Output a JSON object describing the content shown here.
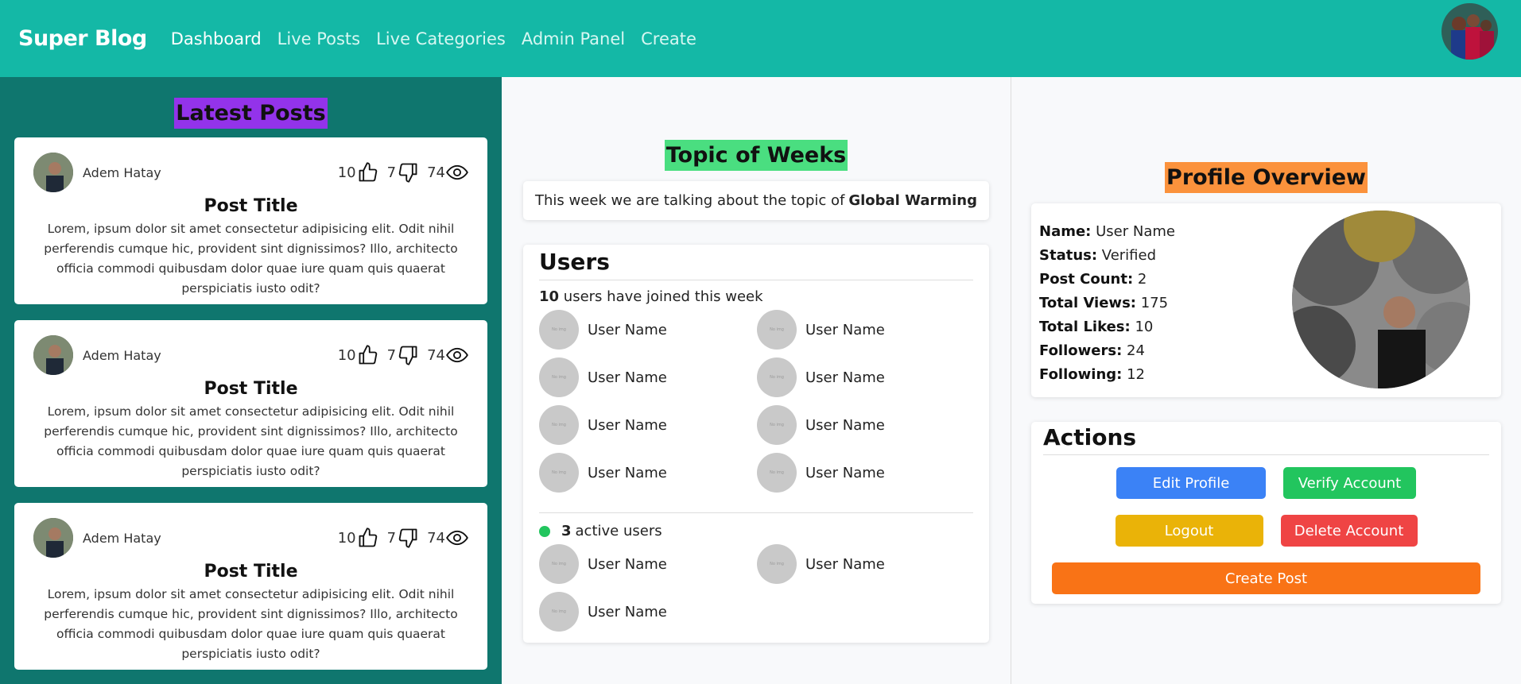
{
  "navbar": {
    "brand": "Super Blog",
    "links": [
      "Dashboard",
      "Live Posts",
      "Live Categories",
      "Admin Panel",
      "Create"
    ],
    "active_link": "Dashboard"
  },
  "latest_posts": {
    "heading": "Latest Posts",
    "posts": [
      {
        "author": "Adem Hatay",
        "likes": "10",
        "dislikes": "7",
        "views": "74",
        "title": "Post Title",
        "body": "Lorem, ipsum dolor sit amet consectetur adipisicing elit. Odit nihil perferendis cumque hic, provident sint dignissimos? Illo, architecto officia commodi quibusdam dolor quae iure quam quis quaerat perspiciatis iusto odit?"
      },
      {
        "author": "Adem Hatay",
        "likes": "10",
        "dislikes": "7",
        "views": "74",
        "title": "Post Title",
        "body": "Lorem, ipsum dolor sit amet consectetur adipisicing elit. Odit nihil perferendis cumque hic, provident sint dignissimos? Illo, architecto officia commodi quibusdam dolor quae iure quam quis quaerat perspiciatis iusto odit?"
      },
      {
        "author": "Adem Hatay",
        "likes": "10",
        "dislikes": "7",
        "views": "74",
        "title": "Post Title",
        "body": "Lorem, ipsum dolor sit amet consectetur adipisicing elit. Odit nihil perferendis cumque hic, provident sint dignissimos? Illo, architecto officia commodi quibusdam dolor quae iure quam quis quaerat perspiciatis iusto odit?"
      }
    ]
  },
  "topic": {
    "heading": "Topic of Weeks",
    "text": "This week we are talking about the topic of",
    "topic_name": "Global Warming"
  },
  "users": {
    "heading": "Users",
    "joined_count": "10",
    "joined_text": "users have joined this week",
    "avatar_placeholder": "No img",
    "joined_users": [
      "User Name",
      "User Name",
      "User Name",
      "User Name",
      "User Name",
      "User Name",
      "User Name",
      "User Name"
    ],
    "active_count": "3",
    "active_text": "active users",
    "active_users": [
      "User Name",
      "User Name",
      "User Name"
    ]
  },
  "profile": {
    "heading": "Profile Overview",
    "fields": [
      {
        "label": "Name:",
        "value": "User Name"
      },
      {
        "label": "Status:",
        "value": "Verified"
      },
      {
        "label": "Post Count:",
        "value": "2"
      },
      {
        "label": "Total Views:",
        "value": "175"
      },
      {
        "label": "Total Likes:",
        "value": "10"
      },
      {
        "label": "Followers:",
        "value": "24"
      },
      {
        "label": "Following:",
        "value": "12"
      }
    ]
  },
  "actions": {
    "heading": "Actions",
    "edit_profile": "Edit Profile",
    "verify_account": "Verify Account",
    "logout": "Logout",
    "delete_account": "Delete Account",
    "create_post": "Create Post"
  },
  "colors": {
    "navbar": "#14b8a6",
    "left_panel": "#0f766e",
    "latest_posts_highlight": "#9333ea",
    "topic_highlight": "#4ade80",
    "profile_highlight": "#fb923c",
    "active_dot": "#22c55e"
  }
}
